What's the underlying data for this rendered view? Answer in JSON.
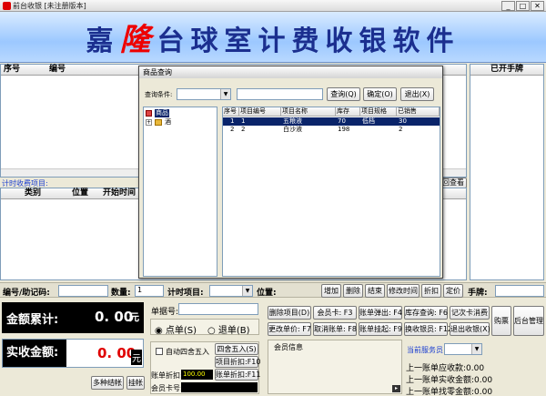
{
  "window": {
    "title": "前台收银 [未注册版本]",
    "min": "_",
    "max": "□",
    "close": "✕"
  },
  "banner": {
    "part1": "嘉",
    "highlight": "隆",
    "part2": "台球室计费收银软件"
  },
  "left_table": {
    "col_no": "序号",
    "col_code": "编号"
  },
  "right_panel": {
    "title": "已开手牌"
  },
  "timing": {
    "label": "计时收费项目:",
    "col_type": "类别",
    "col_pos": "位置",
    "col_start": "开始时间",
    "view_btn": "回查看"
  },
  "dialog": {
    "title": "商品查询",
    "query_label": "查询条件:",
    "query_btn": "查询(Q)",
    "ok_btn": "确定(O)",
    "exit_btn": "退出(X)",
    "tree": {
      "root": "商品",
      "child": "酒"
    },
    "grid_headers": [
      "序号",
      "项目编号",
      "项目名称",
      "库存",
      "项目规格",
      "已销售"
    ],
    "rows": [
      [
        "1",
        "1",
        "五粮液",
        "70",
        "低档",
        "30"
      ],
      [
        "2",
        "2",
        "白沙液",
        "198",
        "",
        "2"
      ]
    ]
  },
  "entry": {
    "code_label": "编号/助记码:",
    "qty_label": "数量:",
    "qty_value": "1",
    "timing_label": "计时项目:",
    "pos_label": "位置:",
    "btn_add": "增加",
    "btn_delete": "删除",
    "btn_finish": "结束",
    "btn_modify_time": "修改时间",
    "btn_discount": "折扣",
    "btn_fixed_price": "定价",
    "plate_label": "手牌:"
  },
  "totals": {
    "total_label": "金额累计:",
    "total_value": "0. 00",
    "unit": "元",
    "paid_label": "实收金额:",
    "paid_value": "0. 00",
    "multi_btn": "多种结帐",
    "hang_btn": "挂帐"
  },
  "order": {
    "bill_label": "单据号:",
    "radio_dine": "点单(S)",
    "radio_return": "退单(B)",
    "auto_round": "自动四舍五入",
    "round_btn": "四舍五入(S)",
    "item_discount_btn": "项目折扣:F10",
    "bill_discount_label": "账单折扣:",
    "bill_discount_value": "100.00",
    "bill_discount_btn": "账单折扣:F11",
    "member_card_label": "会员卡号:"
  },
  "actions": {
    "row1": [
      "删除项目(D)",
      "会员卡: F3",
      "账单弹出: F4",
      "库存查询: F6",
      "记次卡消费"
    ],
    "row2": [
      "更改单价: F7",
      "取消账单: F8",
      "账单挂起: F9",
      "换收银员: F12",
      "退出收银(X)"
    ],
    "buy_btn": "购票",
    "backend_btn": "后台管理",
    "member_info": "会员信息",
    "staff_label": "当前服务员"
  },
  "last_bill": {
    "receivable": "上一账单应收款:0.00",
    "paid": "上一账单实收金额:0.00",
    "change": "上一账单找零金额:0.00"
  },
  "colors": {
    "accent": "#1b2f8f",
    "highlight_red": "#e00000",
    "select_blue": "#0a246a",
    "link_blue": "#1a3dd0"
  }
}
